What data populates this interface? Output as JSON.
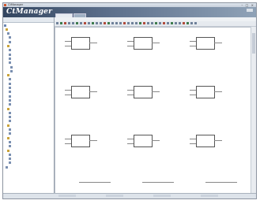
{
  "window": {
    "title": "CtManager"
  },
  "banner": {
    "logo": "CtManager",
    "tabs": [
      "",
      ""
    ]
  },
  "sidebar": {
    "header": "",
    "items": [
      {
        "label": "",
        "color": "#6b86b0"
      },
      {
        "label": "",
        "color": "#c9a33a"
      },
      {
        "label": "",
        "color": "#7a8fb0"
      },
      {
        "label": "",
        "color": "#7a8fb0"
      },
      {
        "label": "",
        "color": "#7a8fb0"
      },
      {
        "label": "",
        "color": "#c9a33a"
      },
      {
        "label": "",
        "color": "#7a8fb0"
      },
      {
        "label": "",
        "color": "#7a8fb0"
      },
      {
        "label": "",
        "color": "#7a8fb0"
      },
      {
        "label": "",
        "color": "#7a8fb0"
      },
      {
        "label": "",
        "color": "#7a8fb0"
      },
      {
        "label": "",
        "color": "#7a8fb0"
      },
      {
        "label": "",
        "color": "#c9a33a"
      },
      {
        "label": "",
        "color": "#7a8fb0"
      },
      {
        "label": "",
        "color": "#7a8fb0"
      },
      {
        "label": "",
        "color": "#7a8fb0"
      },
      {
        "label": "",
        "color": "#7a8fb0"
      },
      {
        "label": "",
        "color": "#7a8fb0"
      },
      {
        "label": "",
        "color": "#7a8fb0"
      },
      {
        "label": "",
        "color": "#7a8fb0"
      },
      {
        "label": "",
        "color": "#c9a33a"
      },
      {
        "label": "",
        "color": "#7a8fb0"
      },
      {
        "label": "",
        "color": "#7a8fb0"
      },
      {
        "label": "",
        "color": "#7a8fb0"
      },
      {
        "label": "",
        "color": "#c9a33a"
      },
      {
        "label": "",
        "color": "#7a8fb0"
      },
      {
        "label": "",
        "color": "#7a8fb0"
      },
      {
        "label": "",
        "color": "#c9a33a"
      },
      {
        "label": "",
        "color": "#7a8fb0"
      },
      {
        "label": "",
        "color": "#7a8fb0"
      },
      {
        "label": "",
        "color": "#c9a33a"
      },
      {
        "label": "",
        "color": "#7a8fb0"
      },
      {
        "label": "",
        "color": "#7a8fb0"
      },
      {
        "label": "",
        "color": "#7a8fb0"
      },
      {
        "label": "",
        "color": "#7a8fb0"
      }
    ]
  },
  "menu": [
    "",
    "",
    "",
    "",
    ""
  ],
  "toolbar": {
    "labels": [
      "",
      "",
      "",
      "",
      ""
    ]
  },
  "diagram": {
    "blocks": [
      {
        "name": "",
        "pins_in": [
          "",
          ""
        ],
        "pins_out": [
          ""
        ]
      },
      {
        "name": "",
        "pins_in": [
          "",
          ""
        ],
        "pins_out": [
          ""
        ]
      },
      {
        "name": "",
        "pins_in": [
          "",
          ""
        ],
        "pins_out": [
          ""
        ]
      },
      {
        "name": "",
        "pins_in": [
          "",
          ""
        ],
        "pins_out": [
          ""
        ]
      },
      {
        "name": "",
        "pins_in": [
          "",
          ""
        ],
        "pins_out": [
          ""
        ]
      },
      {
        "name": "",
        "pins_in": [
          "",
          ""
        ],
        "pins_out": [
          ""
        ]
      },
      {
        "name": "",
        "pins_in": [
          "",
          ""
        ],
        "pins_out": [
          ""
        ]
      },
      {
        "name": "",
        "pins_in": [
          "",
          ""
        ],
        "pins_out": [
          ""
        ]
      },
      {
        "name": "",
        "pins_in": [
          "",
          ""
        ],
        "pins_out": [
          ""
        ]
      }
    ]
  }
}
